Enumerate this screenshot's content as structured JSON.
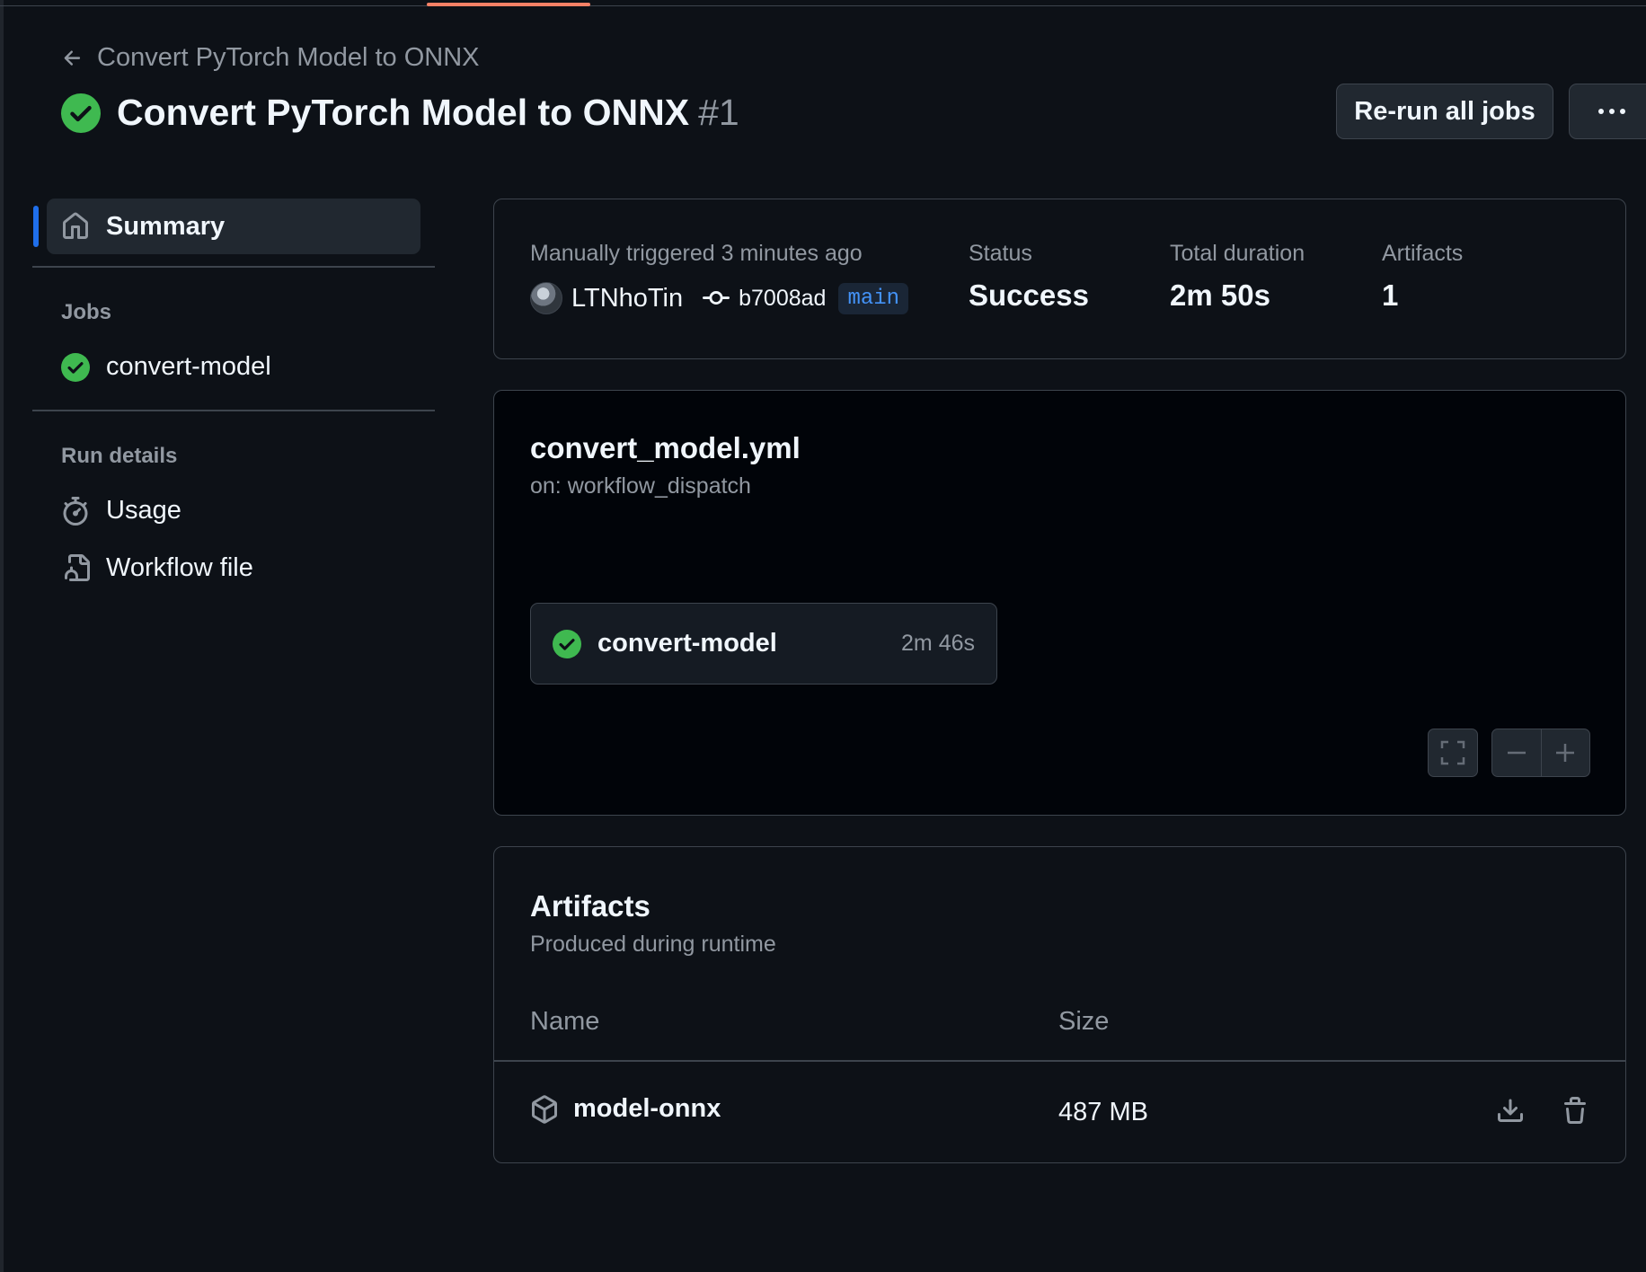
{
  "colors": {
    "background": "#0d1117",
    "success": "#3fb950",
    "accent": "#1f6feb",
    "link_blue": "#4493f8",
    "muted_text": "#9198a1",
    "border": "#3d444d",
    "tab_underline": "#f78166"
  },
  "header": {
    "back_link": "Convert PyTorch Model to ONNX",
    "title": "Convert PyTorch Model to ONNX",
    "run_number": "#1",
    "status_icon": "check-circle-fill-icon",
    "rerun_button": "Re-run all jobs",
    "more_button_icon": "kebab-horizontal-icon"
  },
  "sidebar": {
    "summary_label": "Summary",
    "jobs_heading": "Jobs",
    "jobs": [
      {
        "name": "convert-model",
        "status": "success"
      }
    ],
    "run_details_heading": "Run details",
    "run_details": [
      {
        "label": "Usage",
        "icon": "stopwatch-icon"
      },
      {
        "label": "Workflow file",
        "icon": "file-code-icon"
      }
    ]
  },
  "summary": {
    "trigger_label": "Manually triggered 3 minutes ago",
    "actor": "LTNhoTin",
    "commit_sha": "b7008ad",
    "branch": "main",
    "status_label": "Status",
    "status_value": "Success",
    "duration_label": "Total duration",
    "duration_value": "2m 50s",
    "artifacts_label": "Artifacts",
    "artifacts_value": "1"
  },
  "workflow": {
    "filename": "convert_model.yml",
    "trigger": "on: workflow_dispatch",
    "job": {
      "name": "convert-model",
      "duration": "2m 46s",
      "status": "success"
    }
  },
  "artifacts": {
    "title": "Artifacts",
    "subtitle": "Produced during runtime",
    "columns": {
      "name": "Name",
      "size": "Size"
    },
    "rows": [
      {
        "name": "model-onnx",
        "size": "487 MB"
      }
    ]
  }
}
